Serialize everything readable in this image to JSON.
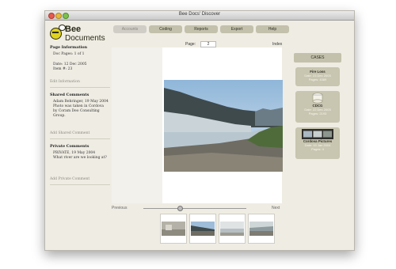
{
  "window": {
    "title": "Bee Docs' Discover"
  },
  "toolbar": {
    "buttons": [
      {
        "label": "Accounts",
        "active": true
      },
      {
        "label": "Coding",
        "active": false
      },
      {
        "label": "Reports",
        "active": false
      },
      {
        "label": "Export",
        "active": false
      },
      {
        "label": "Help",
        "active": false
      }
    ]
  },
  "logo": {
    "line1": "Bee",
    "line2": "Documents"
  },
  "sidebar": {
    "page_info_heading": "Page Information",
    "doc_pages": "Doc Pages: 1 of 1",
    "date": "Date: 12 Dec 2005",
    "item": "Item #: 23",
    "edit_link": "Edit Information",
    "shared_heading": "Shared Comments",
    "shared_comment_author": "Adam Behringer, 19 May 2004",
    "shared_comment_text": "Photo was taken in Cordova by Coram Deo Consulting Group.",
    "add_shared_link": "Add Shared Comment",
    "private_heading": "Private Comments",
    "private_comment_author": "PRIVATE, 19 May 2004",
    "private_comment_text": "What river are we looking at?",
    "add_private_link": "Add Private Comment"
  },
  "viewer": {
    "page_label": "Page:",
    "page_value": "2",
    "index_label": "Index",
    "previous_label": "Previous",
    "next_label": "Next",
    "scroll_position": 0.35
  },
  "cases_panel": {
    "heading": "CASES",
    "cases": [
      {
        "name": "Fire Loss",
        "date": "Date: 23 Dec 2003",
        "pages": "Pages: 4389"
      },
      {
        "name": "CDCG",
        "date": "Date: 22 Dec 2003",
        "pages": "Pages: 2193"
      },
      {
        "name": "Cordova Pictures",
        "date": "Date: 19 Jan 2004",
        "pages": "Pages: 4"
      }
    ]
  },
  "colors": {
    "window_bg": "#efece3",
    "button_bg": "#c3c1ab",
    "case_bg": "#c8c5b0",
    "logo_yellow": "#e0d21f"
  },
  "icons": [
    "close-icon",
    "minimize-icon",
    "zoom-icon",
    "bee-logo-icon"
  ]
}
